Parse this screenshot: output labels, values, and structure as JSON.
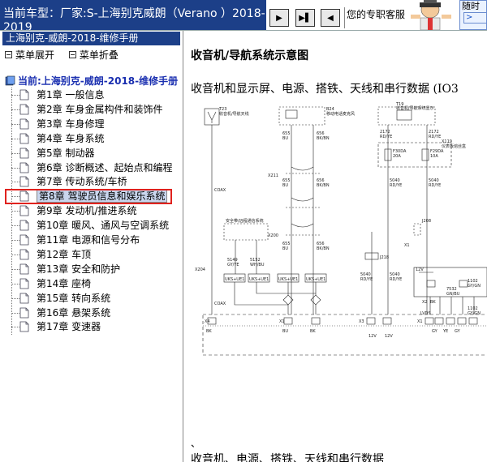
{
  "header": {
    "car_model_label": "当前车型：",
    "car_model_value": "厂家:S-上海别克威朗（Verano ）2018-2019",
    "consult_text": "您的专职客服",
    "chat_label": "随时",
    "chat_button": ">"
  },
  "sidebar": {
    "manual_title": "上海别克-威朗-2018-维修手册",
    "expand_label": "菜单展开",
    "collapse_label": "菜单折叠",
    "root_label": "当前:上海别克-威朗-2018-维修手册",
    "items": [
      {
        "label": "第1章 一般信息"
      },
      {
        "label": "第2章 车身金属构件和装饰件"
      },
      {
        "label": "第3章 车身修理"
      },
      {
        "label": "第4章 车身系统"
      },
      {
        "label": "第5章 制动器"
      },
      {
        "label": "第6章 诊断概述、起始点和编程"
      },
      {
        "label": "第7章 传动系统/车桥"
      },
      {
        "label": "第8章 驾驶员信息和娱乐系统"
      },
      {
        "label": "第9章 发动机/推进系统"
      },
      {
        "label": "第10章 暖风、通风与空调系统"
      },
      {
        "label": "第11章 电源和信号分布"
      },
      {
        "label": "第12章 车顶"
      },
      {
        "label": "第13章 安全和防护"
      },
      {
        "label": "第14章 座椅"
      },
      {
        "label": "第15章 转向系统"
      },
      {
        "label": "第16章 悬架系统"
      },
      {
        "label": "第17章 变速器"
      }
    ],
    "selected_index": 7
  },
  "content": {
    "heading": "收音机/导航系统示意图",
    "description": "收音机和显示屏、电源、搭铁、天线和串行数据 (IO3",
    "comma": "、",
    "bottom_text": "收音机、电源、搭铁、天线和串行数据",
    "diagram": {
      "labels": {
        "t223": "T23",
        "t223_desc": "收音机/导航天线",
        "coax": "COAX",
        "b24": "B24",
        "b24_desc": "移动电话麦克风",
        "t19": "T19",
        "t19_desc": "收音机/导航系统显示",
        "w655a": "655",
        "w655a_c": "BU",
        "w656a": "656",
        "w656a_c": "BK/BN",
        "w655b": "655",
        "w655b_c": "BU",
        "w656b": "656",
        "w656b_c": "BK/BN",
        "w655c": "655",
        "w655c_c": "BU",
        "w656c": "656",
        "w656c_c": "BK/BN",
        "x211": "X211",
        "x200": "X200",
        "x204": "X204",
        "pin1": "1",
        "pin2": "2",
        "pin9a": "9",
        "pin8": "8",
        "pin9b": "9",
        "pin6": "6",
        "pin10": "10",
        "pin7": "7",
        "fuse_box": "安全带/远程通信系统",
        "w5149": "5149",
        "w5149_c": "GY/YE",
        "w5152": "5152",
        "w5152_c": "WH/BU",
        "uks1": "UKS+UE1",
        "uks2": "UKS+UE1",
        "uks3": "UKS+UE1",
        "uks4": "UKS+UE1",
        "w2172a": "2172",
        "w2172a_c": "RD/YE",
        "w2172b": "2172",
        "w2172b_c": "RD/YE",
        "f30da": "F30DA",
        "f30da_a": "20A",
        "f29da": "F29DA",
        "f29da_a": "10A",
        "x119": "X119",
        "x119_desc": "仪表板熔丝盒",
        "w5040a": "5040",
        "w5040a_c": "RD/YE",
        "w5040b": "5040",
        "w5040b_c": "RD/YE",
        "j218": "J218",
        "w5040c": "5040",
        "w5040c_c": "RD/YE",
        "w5040d": "5040",
        "w5040d_c": "RD/YE",
        "j208": "J208",
        "x1a": "X1",
        "x2": "X2",
        "bk1": "BK",
        "bk2": "BK",
        "bu": "BU",
        "bk3": "BK",
        "gy": "GY",
        "ye": "YE",
        "gy2": "GY",
        "lvds": "LVDS",
        "w1102a": "1102",
        "w1102a_c": "GY/GN",
        "w7532": "7532",
        "w7532_c": "GN/BU",
        "w1102b": "1102",
        "w1102b_c": "GY/GN",
        "v12a": "12V",
        "v12b": "12V",
        "v12c": "12V",
        "x1b": "X1",
        "x4": "X4",
        "x3": "X3",
        "x1c": "X1",
        "p16": "16",
        "p8": "8",
        "p20": "20",
        "p21": "21",
        "p2": "2",
        "p4": "4",
        "p1": "1",
        "p3": "3",
        "p7": "7"
      }
    }
  }
}
